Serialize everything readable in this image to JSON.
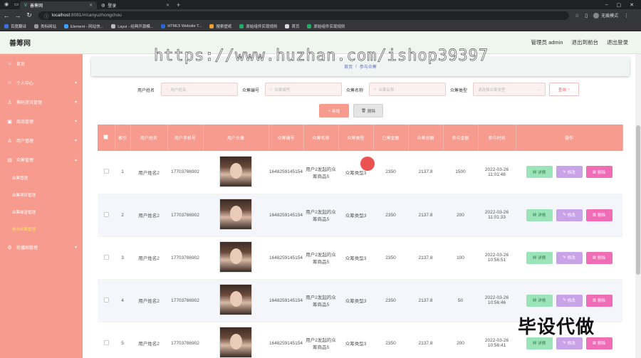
{
  "browser": {
    "tabs": [
      {
        "label": "善筹网",
        "active": true
      },
      {
        "label": "登录",
        "active": false
      }
    ],
    "url_host": "localhost",
    "url_path": ":8081/#/canyuzhongchou",
    "profile_label": "无痕模式",
    "bookmarks": [
      "百度翻译",
      "类标网站",
      "Element - 网站快...",
      "Layui - 经典开源模...",
      "HTML5 Website T...",
      "搜索壁纸",
      "原始组件实现规则",
      "首页",
      "原始组件实现规则"
    ]
  },
  "header": {
    "brand": "善筹网",
    "user": "管理员 admin",
    "back_link": "退出到前台",
    "logout_link": "退出登录"
  },
  "sidebar": {
    "items": [
      {
        "label": "首页",
        "icon": "home-icon"
      },
      {
        "label": "个人中心",
        "icon": "user-icon",
        "expandable": true
      },
      {
        "label": "筹码资讯管理",
        "icon": "person-icon",
        "expandable": true
      },
      {
        "label": "商品管理",
        "icon": "box-icon",
        "expandable": true
      },
      {
        "label": "用户管理",
        "icon": "person-icon",
        "expandable": true
      },
      {
        "label": "众筹管理",
        "icon": "folder-icon",
        "expandable": true,
        "open": true
      }
    ],
    "sub_items": [
      {
        "label": "众筹管理",
        "active": false
      },
      {
        "label": "众筹项目管理",
        "active": false
      },
      {
        "label": "众筹缘逢管理",
        "active": false
      },
      {
        "label": "参与众筹管理",
        "active": true
      }
    ],
    "last_item": {
      "label": "轮播图管理",
      "icon": "gear-icon"
    }
  },
  "breadcrumb": {
    "home": "首页",
    "separator": "/",
    "current": "参与众筹"
  },
  "watermark_url": "https://www.huzhan.com/ishop39397",
  "watermark_text": "毕设代做",
  "search": {
    "user_name_label": "用户姓名",
    "user_name_placeholder": "用户姓名",
    "crowd_no_label": "众筹编号",
    "crowd_no_placeholder": "众筹编号",
    "crowd_name_label": "众筹名称",
    "crowd_name_placeholder": "众筹名称",
    "crowd_type_label": "众筹类型",
    "crowd_type_placeholder": "请选择众筹类型",
    "query_button": "查询"
  },
  "actions": {
    "add": "新增",
    "delete": "删除"
  },
  "table": {
    "headers": [
      "索引",
      "用户姓名",
      "用户手机号",
      "用户头像",
      "众筹编号",
      "众筹名称",
      "众筹类型",
      "已筹金额",
      "众筹总额",
      "参与金额",
      "参与时间",
      "操作"
    ],
    "op_labels": {
      "detail": "详情",
      "edit": "修改",
      "remove": "删除"
    },
    "rows": [
      {
        "index": "1",
        "name": "用户姓名2",
        "phone": "17703786902",
        "crowd_no": "1648259145154",
        "crowd_name": "用户2发起的众筹商品5",
        "crowd_type": "众筹类型3",
        "raised": "2350",
        "total": "2137.8",
        "amount": "1500",
        "time": "2022-03-26 11:01:48"
      },
      {
        "index": "2",
        "name": "用户姓名2",
        "phone": "17703786902",
        "crowd_no": "1648259145154",
        "crowd_name": "用户2发起的众筹商品5",
        "crowd_type": "众筹类型3",
        "raised": "2350",
        "total": "2137.8",
        "amount": "200",
        "time": "2022-03-26 11:01:33"
      },
      {
        "index": "3",
        "name": "用户姓名2",
        "phone": "17703786902",
        "crowd_no": "1648259145154",
        "crowd_name": "用户2发起的众筹商品5",
        "crowd_type": "众筹类型3",
        "raised": "2350",
        "total": "2137.8",
        "amount": "100",
        "time": "2022-03-26 10:56:51"
      },
      {
        "index": "4",
        "name": "用户姓名2",
        "phone": "17703786902",
        "crowd_no": "1648259145154",
        "crowd_name": "用户2发起的众筹商品5",
        "crowd_type": "众筹类型3",
        "raised": "2350",
        "total": "2137.8",
        "amount": "50",
        "time": "2022-03-26 10:56:46"
      },
      {
        "index": "5",
        "name": "用户姓名2",
        "phone": "17703786902",
        "crowd_no": "1648259145154",
        "crowd_name": "用户2发起的众筹商品5",
        "crowd_type": "众筹类型3",
        "raised": "2350",
        "total": "2137.8",
        "amount": "200",
        "time": "2022-03-26 10:56:41"
      }
    ]
  },
  "colors": {
    "accent": "#f69b8d",
    "detail": "#9be3b8",
    "edit": "#c9a3e8",
    "remove": "#ef6db5"
  }
}
